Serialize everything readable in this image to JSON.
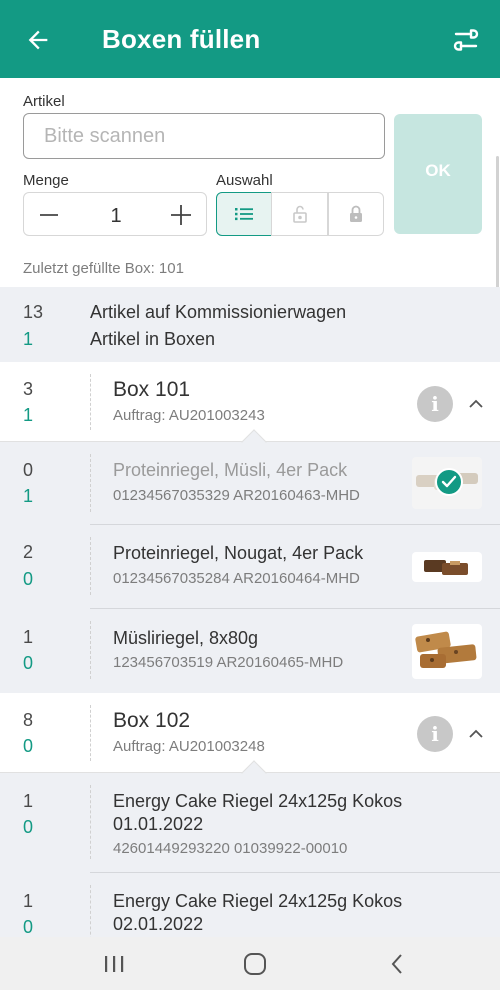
{
  "header": {
    "title": "Boxen füllen",
    "back_icon": "arrow-left-icon",
    "filter_icon": "settings-swap-icon",
    "bg_color": "#139a84"
  },
  "form": {
    "artikel_label": "Artikel",
    "artikel_placeholder": "Bitte scannen",
    "artikel_value": "",
    "menge_label": "Menge",
    "menge_value": "1",
    "auswahl_label": "Auswahl",
    "ok_label": "OK",
    "last_box_text": "Zuletzt gefüllte Box: 101"
  },
  "summary": [
    {
      "count": "13",
      "text": "Artikel auf Kommissionierwagen"
    },
    {
      "count": "1",
      "text": "Artikel in Boxen"
    }
  ],
  "boxes": [
    {
      "count_top": "3",
      "count_bottom": "1",
      "title": "Box 101",
      "order": "Auftrag: AU201003243",
      "items": [
        {
          "count_top": "0",
          "count_bottom": "1",
          "name": "Proteinriegel, Müsli, 4er Pack",
          "code": "01234567035329 AR20160463-MHD",
          "done": true
        },
        {
          "count_top": "2",
          "count_bottom": "0",
          "name": "Proteinriegel, Nougat, 4er Pack",
          "code": "01234567035284 AR20160464-MHD",
          "done": false
        },
        {
          "count_top": "1",
          "count_bottom": "0",
          "name": "Müsliriegel, 8x80g",
          "code": "123456703519 AR20160465-MHD",
          "done": false
        }
      ]
    },
    {
      "count_top": "8",
      "count_bottom": "0",
      "title": "Box 102",
      "order": "Auftrag: AU201003248",
      "items": [
        {
          "count_top": "1",
          "count_bottom": "0",
          "name_line1": "Energy Cake Riegel 24x125g Kokos",
          "name_line2": "01.01.2022",
          "code": "42601449293220 01039922-00010"
        },
        {
          "count_top": "1",
          "count_bottom": "0",
          "name_line1": "Energy Cake Riegel 24x125g Kokos",
          "name_line2": "02.01.2022"
        }
      ]
    }
  ]
}
